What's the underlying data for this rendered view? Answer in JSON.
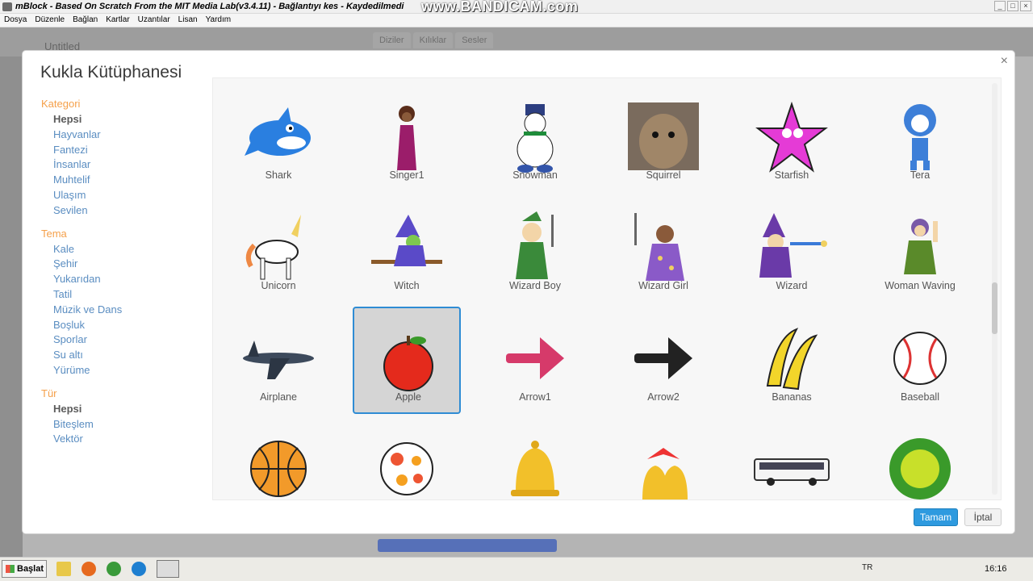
{
  "window": {
    "title": "mBlock - Based On Scratch From the MIT Media Lab(v3.4.11) - Bağlantıyı kes - Kaydedilmedi",
    "watermark": "www.BANDICAM.com"
  },
  "menubar": [
    "Dosya",
    "Düzenle",
    "Bağlan",
    "Kartlar",
    "Uzantılar",
    "Lisan",
    "Yardım"
  ],
  "background": {
    "project_title": "Untitled",
    "tabs": [
      "Diziler",
      "Kılıklar",
      "Sesler"
    ]
  },
  "modal": {
    "title": "Kukla Kütüphanesi",
    "close_glyph": "×",
    "ok_label": "Tamam",
    "cancel_label": "İptal",
    "groups": [
      {
        "heading": "Kategori",
        "items": [
          "Hepsi",
          "Hayvanlar",
          "Fantezi",
          "İnsanlar",
          "Muhtelif",
          "Ulaşım",
          "Sevilen"
        ],
        "active": "Hepsi"
      },
      {
        "heading": "Tema",
        "items": [
          "Kale",
          "Şehir",
          "Yukarıdan",
          "Tatil",
          "Müzik ve Dans",
          "Boşluk",
          "Sporlar",
          "Su altı",
          "Yürüme"
        ],
        "active": null
      },
      {
        "heading": "Tür",
        "items": [
          "Hepsi",
          "Biteşlem",
          "Vektör"
        ],
        "active": "Hepsi"
      }
    ],
    "sprites": [
      {
        "label": "Shark",
        "icon": "shark-icon"
      },
      {
        "label": "Singer1",
        "icon": "singer-icon"
      },
      {
        "label": "Snowman",
        "icon": "snowman-icon"
      },
      {
        "label": "Squirrel",
        "icon": "squirrel-icon"
      },
      {
        "label": "Starfish",
        "icon": "starfish-icon"
      },
      {
        "label": "Tera",
        "icon": "tera-icon"
      },
      {
        "label": "Unicorn",
        "icon": "unicorn-icon"
      },
      {
        "label": "Witch",
        "icon": "witch-icon"
      },
      {
        "label": "Wizard Boy",
        "icon": "wizard-boy-icon"
      },
      {
        "label": "Wizard Girl",
        "icon": "wizard-girl-icon"
      },
      {
        "label": "Wizard",
        "icon": "wizard-icon"
      },
      {
        "label": "Woman Waving",
        "icon": "woman-waving-icon"
      },
      {
        "label": "Airplane",
        "icon": "airplane-icon"
      },
      {
        "label": "Apple",
        "icon": "apple-icon",
        "selected": true
      },
      {
        "label": "Arrow1",
        "icon": "arrow1-icon"
      },
      {
        "label": "Arrow2",
        "icon": "arrow2-icon"
      },
      {
        "label": "Bananas",
        "icon": "bananas-icon"
      },
      {
        "label": "Baseball",
        "icon": "baseball-icon"
      },
      {
        "label": "",
        "icon": "basketball-icon"
      },
      {
        "label": "",
        "icon": "beachball-icon"
      },
      {
        "label": "",
        "icon": "bell-icon"
      },
      {
        "label": "",
        "icon": "bells-icon"
      },
      {
        "label": "",
        "icon": "bus-icon"
      },
      {
        "label": "",
        "icon": "button-icon"
      }
    ]
  },
  "taskbar": {
    "start_label": "Başlat",
    "language": "TR",
    "clock": "16:16"
  }
}
